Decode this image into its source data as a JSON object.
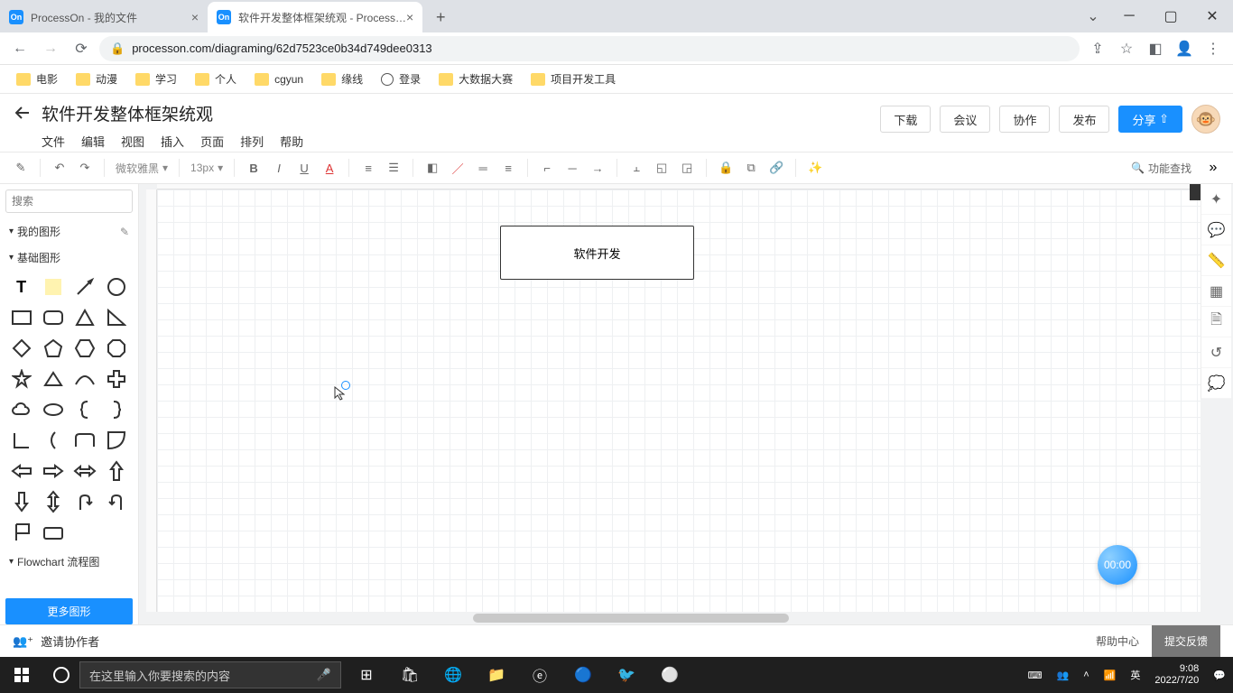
{
  "browser": {
    "tabs": [
      {
        "title": "ProcessOn - 我的文件",
        "active": false
      },
      {
        "title": "软件开发整体框架统观 - Process…",
        "active": true
      }
    ],
    "url": "processon.com/diagraming/62d7523ce0b34d749dee0313"
  },
  "bookmarks": [
    "电影",
    "动漫",
    "学习",
    "个人",
    "cgyun",
    "缘线",
    "登录",
    "大数据大赛",
    "项目开发工具"
  ],
  "app": {
    "doc_title": "软件开发整体框架统观",
    "menus": [
      "文件",
      "编辑",
      "视图",
      "插入",
      "页面",
      "排列",
      "帮助"
    ],
    "actions": {
      "download": "下载",
      "meeting": "会议",
      "collab": "协作",
      "publish": "发布",
      "share": "分享"
    }
  },
  "toolbar": {
    "font": "微软雅黑",
    "size": "13px",
    "func_search": "功能查找"
  },
  "sidebar": {
    "search_placeholder": "搜索",
    "my_shapes": "我的图形",
    "basic_shapes": "基础图形",
    "flowchart": "Flowchart 流程图",
    "more_shapes": "更多图形"
  },
  "canvas": {
    "node_text": "软件开发",
    "timer": "00:00"
  },
  "footer": {
    "invite": "邀请协作者",
    "help": "帮助中心",
    "feedback": "提交反馈"
  },
  "taskbar": {
    "search_placeholder": "在这里输入你要搜索的内容",
    "ime": "英",
    "time": "9:08",
    "date": "2022/7/20"
  }
}
